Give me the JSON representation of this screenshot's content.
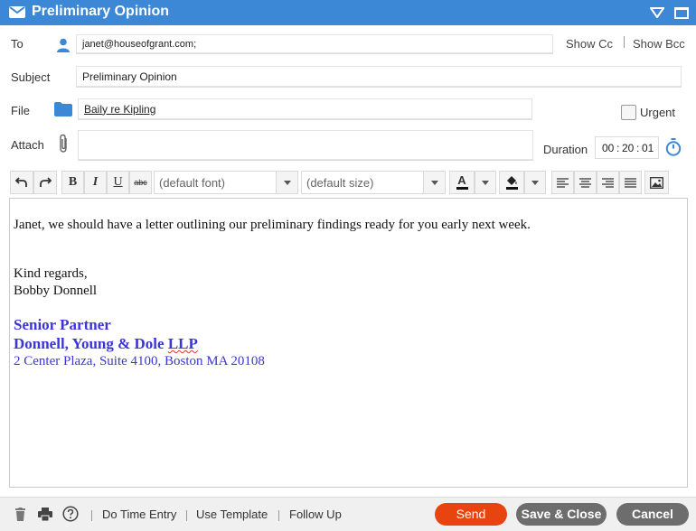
{
  "window": {
    "title": "Preliminary Opinion"
  },
  "colors": {
    "titlebar": "#3c87d6",
    "send": "#e8440f",
    "secondary": "#6d6d6d",
    "signature": "#3b35d8"
  },
  "form": {
    "to_label": "To",
    "to_value": "janet@houseofgrant.com;",
    "show_cc": "Show Cc",
    "show_bcc": "Show Bcc",
    "subject_label": "Subject",
    "subject_value": "Preliminary Opinion",
    "file_label": "File",
    "file_value": "Baily re Kipling",
    "urgent_label": "Urgent",
    "urgent_checked": false,
    "attach_label": "Attach",
    "duration_label": "Duration",
    "duration": {
      "hh": "00",
      "mm": "20",
      "ss": "01"
    }
  },
  "toolbar": {
    "font_placeholder": "(default font)",
    "size_placeholder": "(default size)",
    "bold": "B",
    "italic": "I",
    "underline": "U",
    "strike": "abc",
    "text_color_letter": "A",
    "icons": [
      "undo-icon",
      "redo-icon",
      "bold-icon",
      "italic-icon",
      "underline-icon",
      "strikethrough-icon",
      "text-color-icon",
      "highlight-icon",
      "align-left-icon",
      "align-center-icon",
      "align-right-icon",
      "justify-icon",
      "image-icon"
    ]
  },
  "body": {
    "line1": "Janet, we should have a letter outlining our preliminary findings ready for you early next week.",
    "closing": "Kind regards,",
    "sender_name": "Bobby Donnell",
    "sig_title": "Senior Partner",
    "sig_firm_prefix": "Donnell, Young & Dole ",
    "sig_firm_suffix": "LLP",
    "sig_address": "2 Center Plaza, Suite 4100, Boston MA 20108"
  },
  "footer": {
    "time_entry": "Do Time Entry",
    "use_template": "Use Template",
    "follow_up": "Follow Up",
    "send": "Send",
    "save_close": "Save & Close",
    "cancel": "Cancel"
  }
}
